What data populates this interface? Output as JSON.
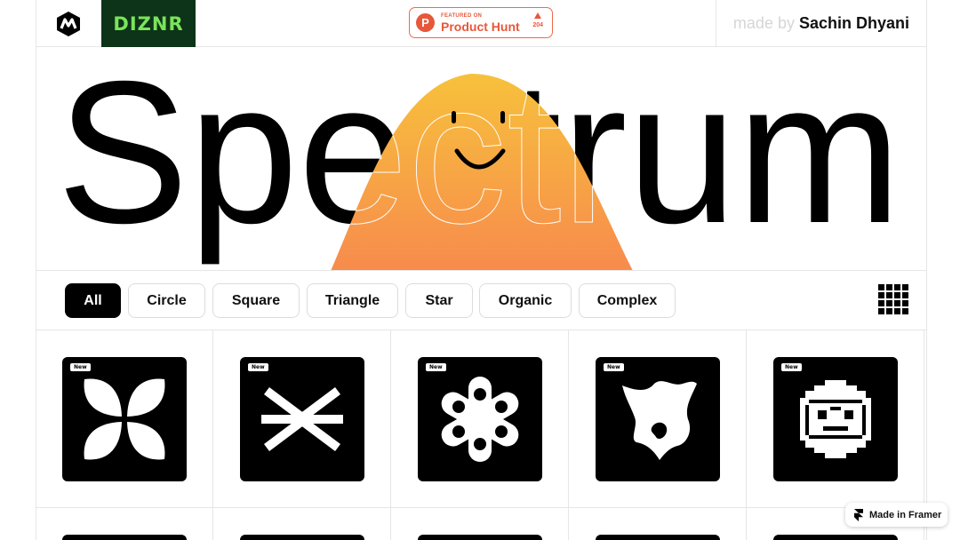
{
  "header": {
    "brand_badge": "DIZNR",
    "product_hunt": {
      "small": "FEATURED ON",
      "big": "Product Hunt",
      "votes": "204"
    },
    "made_by": {
      "prefix": "made by",
      "name": "Sachin Dhyani"
    }
  },
  "hero": {
    "title": "Spectrum",
    "mascot_colors": [
      "#f7c13c",
      "#f78b4d"
    ]
  },
  "filters": {
    "chips": [
      {
        "label": "All",
        "active": true
      },
      {
        "label": "Circle",
        "active": false
      },
      {
        "label": "Square",
        "active": false
      },
      {
        "label": "Triangle",
        "active": false
      },
      {
        "label": "Star",
        "active": false
      },
      {
        "label": "Organic",
        "active": false
      },
      {
        "label": "Complex",
        "active": false
      }
    ]
  },
  "cards": [
    {
      "badge": "New",
      "shape": "clover-icon"
    },
    {
      "badge": "New",
      "shape": "cross-asterisk-icon"
    },
    {
      "badge": "New",
      "shape": "flower-icon"
    },
    {
      "badge": "New",
      "shape": "splat-star-icon"
    },
    {
      "badge": "New",
      "shape": "pixel-smiley-icon"
    }
  ],
  "framer_badge": "Made in Framer",
  "colors": {
    "brand_bg": "#0d3318",
    "brand_fg": "#7be35a",
    "ph_accent": "#e8573a"
  }
}
